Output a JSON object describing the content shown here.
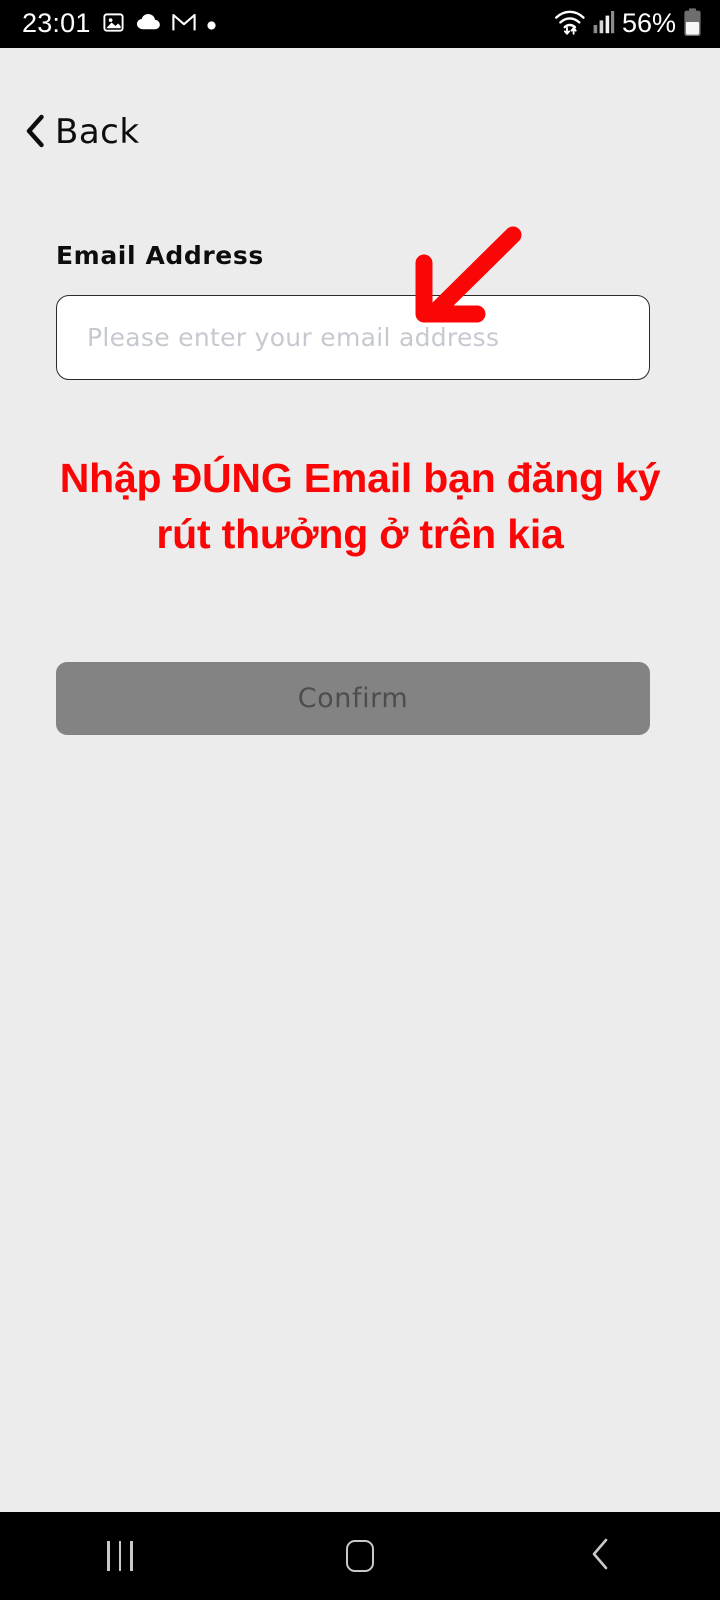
{
  "status_bar": {
    "time": "23:01",
    "battery_percent": "56%",
    "left_icons": [
      "photo-icon",
      "cloud-icon",
      "gmail-icon",
      "dot-icon"
    ],
    "right_icons": [
      "wifi-icon",
      "cellular-signal-icon",
      "battery-icon"
    ],
    "colors": {
      "background": "#000000",
      "foreground": "#ffffff"
    }
  },
  "header": {
    "back_label": "Back",
    "back_icon": "chevron-left-icon"
  },
  "form": {
    "email_label": "Email Address",
    "email_value": "",
    "email_placeholder": "Please enter your email address",
    "confirm_label": "Confirm",
    "confirm_disabled": true,
    "colors": {
      "page_background": "#ececec",
      "input_background": "#ffffff",
      "input_border": "#2b2b2b",
      "placeholder": "#c7c9d1",
      "button_background": "#838383",
      "button_text": "#4d4d4d"
    }
  },
  "annotation": {
    "notice_line_1": "Nhập ĐÚNG Email bạn đăng ký",
    "notice_line_2": "rút thưởng ở trên kia",
    "notice_color": "#fb0606",
    "arrow_icon": "red-arrow-down-left-icon",
    "arrow_color": "#fb0606"
  },
  "nav_bar": {
    "recents_label": "recent-apps",
    "home_label": "home",
    "back_label": "back",
    "colors": {
      "background": "#000000",
      "foreground": "#c9c9c9"
    }
  }
}
